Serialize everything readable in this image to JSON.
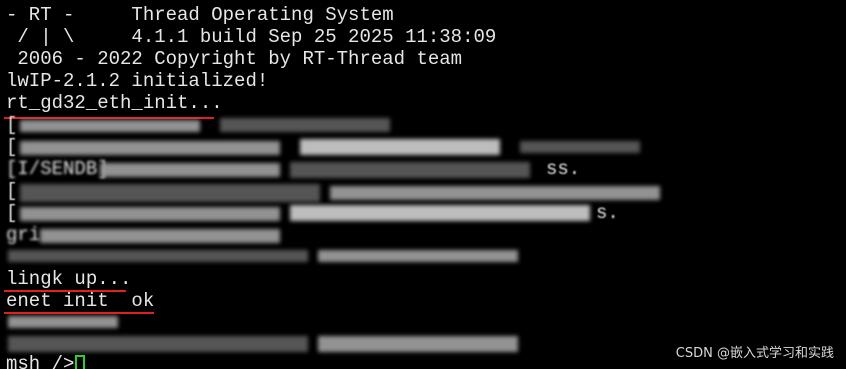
{
  "terminal": {
    "banner": [
      "- RT -     Thread Operating System",
      " / | \\     4.1.1 build Sep 25 2025 11:38:09",
      " 2006 - 2022 Copyright by RT-Thread team"
    ],
    "lwip_line": "lwIP-2.1.2 initialized!",
    "eth_init_line": "rt_gd32_eth_init...",
    "blurred_fragments": [
      "[",
      "[",
      "[I/SENDB]",
      "[",
      "[",
      "ss.",
      "s.",
      "gri"
    ],
    "link_line": "lingk up...",
    "enet_line": "enet init  ok",
    "prompt": "msh />",
    "colors": {
      "background": "#000000",
      "text": "#e6e6e6",
      "underline": "#e02020",
      "cursor": "#2bd12b"
    }
  },
  "watermark": "CSDN @嵌入式学习和实践"
}
